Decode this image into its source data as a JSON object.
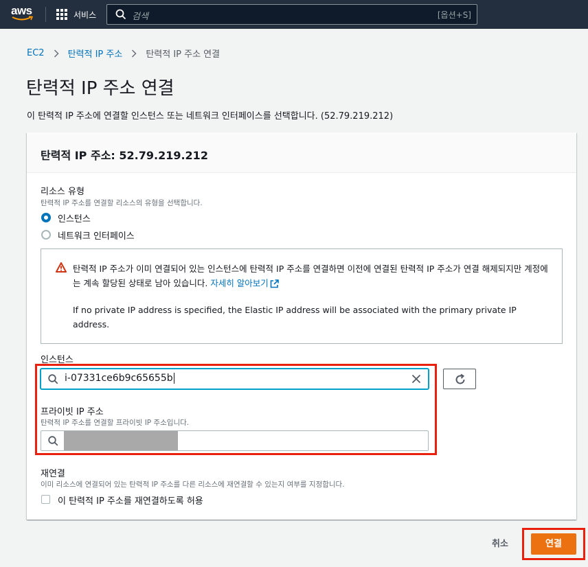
{
  "topnav": {
    "logo_text": "aws",
    "services_label": "서비스",
    "search_placeholder": "검색",
    "search_shortcut": "[옵션+S]"
  },
  "breadcrumb": {
    "items": [
      "EC2",
      "탄력적 IP 주소"
    ],
    "current": "탄력적 IP 주소 연결"
  },
  "page": {
    "title": "탄력적 IP 주소 연결",
    "description": "이 탄력적 IP 주소에 연결할 인스턴스 또는 네트워크 인터페이스를 선택합니다. (52.79.219.212)"
  },
  "panel": {
    "title": "탄력적 IP 주소: 52.79.219.212",
    "resource_type": {
      "label": "리소스 유형",
      "description": "탄력적 IP 주소를 연결할 리소스의 유형을 선택합니다.",
      "options": [
        "인스턴스",
        "네트워크 인터페이스"
      ],
      "selected": "인스턴스"
    },
    "warning": {
      "text": "탄력적 IP 주소가 이미 연결되어 있는 인스턴스에 탄력적 IP 주소를 연결하면 이전에 연결된 탄력적 IP 주소가 연결 해제되지만 계정에는 계속 할당된 상태로 남아 있습니다.",
      "link": "자세히 알아보기",
      "note": "If no private IP address is specified, the Elastic IP address will be associated with the primary private IP address."
    },
    "instance": {
      "label": "인스턴스",
      "value": "i-07331ce6b9c65655b"
    },
    "private_ip": {
      "label": "프라이빗 IP 주소",
      "description": "탄력적 IP 주소를 연결할 프라이빗 IP 주소입니다."
    },
    "reassociation": {
      "label": "재연결",
      "description": "이미 리소스에 연결되어 있는 탄력적 IP 주소를 다른 리소스에 재연결할 수 있는지 여부를 지정합니다.",
      "checkbox_label": "이 탄력적 IP 주소를 재연결하도록 허용",
      "checked": false
    }
  },
  "footer": {
    "cancel_label": "취소",
    "connect_label": "연결"
  },
  "colors": {
    "nav_bg": "#232f3e",
    "link": "#0073bb",
    "primary": "#ec7211",
    "highlight": "#e8200d",
    "warning_icon": "#d13212"
  }
}
